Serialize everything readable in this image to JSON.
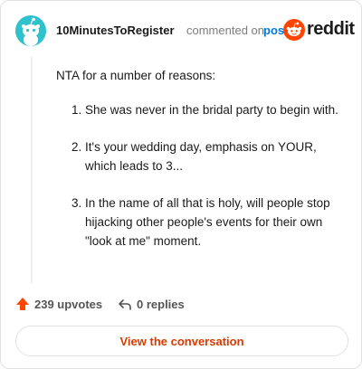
{
  "header": {
    "username": "10MinutesToRegister",
    "action_text": "commented on",
    "post_link": "post",
    "logo_text": "reddit"
  },
  "comment": {
    "intro": "NTA for a number of reasons:",
    "reasons": [
      "She was never in the bridal party to begin with.",
      "It's your wedding day, emphasis on YOUR, which leads to 3...",
      "In the name of all that is holy, will people stop hijacking other people's events for their own \"look at me\" moment."
    ]
  },
  "actions": {
    "upvotes": "239 upvotes",
    "replies": "0 replies"
  },
  "footer": {
    "view_button": "View the conversation"
  },
  "colors": {
    "reddit_orange": "#ff4500",
    "link_blue": "#0079d3",
    "button_text": "#d93a00",
    "avatar_bg": "#2fc1cc"
  },
  "icons": [
    "snoo-avatar-icon",
    "reddit-logo-icon",
    "upvote-arrow-icon",
    "reply-arrow-icon"
  ]
}
